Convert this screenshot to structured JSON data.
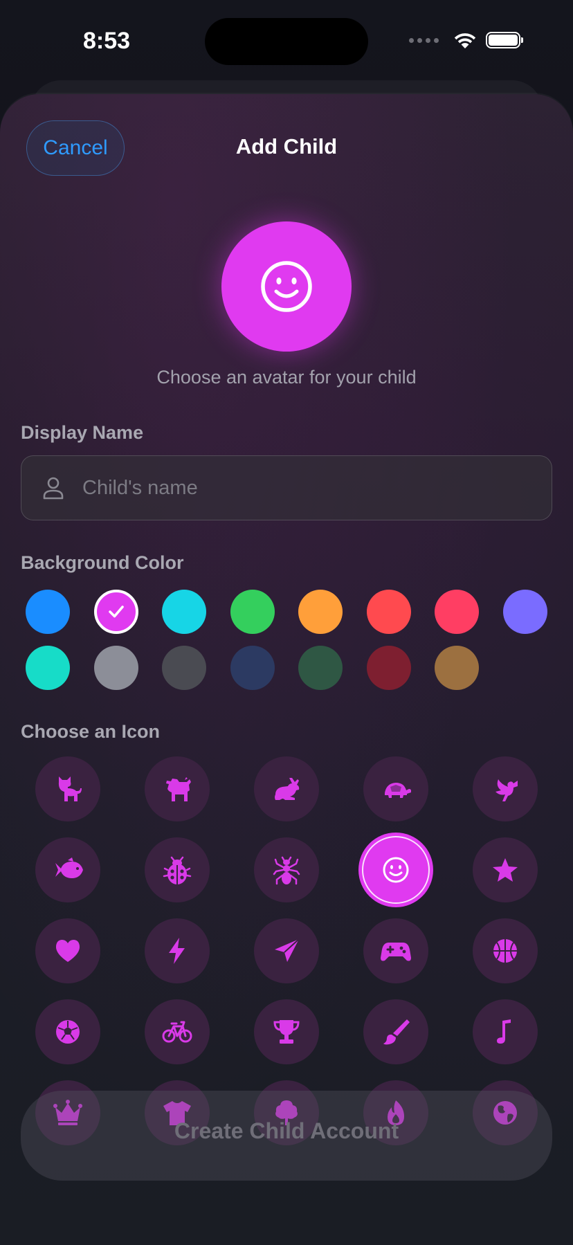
{
  "status_bar": {
    "time": "8:53"
  },
  "header": {
    "cancel_label": "Cancel",
    "title": "Add Child"
  },
  "avatar": {
    "icon": "smiley-face-icon",
    "color": "#e03af0",
    "caption": "Choose an avatar for your child"
  },
  "display_name": {
    "label": "Display Name",
    "value": "",
    "placeholder": "Child's name"
  },
  "background_color": {
    "label": "Background Color",
    "selected_index": 1,
    "colors": [
      "#1a8dff",
      "#e03af0",
      "#17d5e6",
      "#34cf5d",
      "#ff9f3a",
      "#ff4a4f",
      "#ff3e63",
      "#7a6cff",
      "#17dcc8",
      "#8c8e98",
      "#4a4b52",
      "#2c3a62",
      "#2f5744",
      "#7e1f30",
      "#9c7040"
    ]
  },
  "icon_picker": {
    "label": "Choose an Icon",
    "selected_index": 8,
    "icons": [
      "cat-icon",
      "dog-icon",
      "rabbit-icon",
      "tortoise-icon",
      "bird-icon",
      "fish-icon",
      "ladybug-icon",
      "ant-icon",
      "smiley-face-icon",
      "star-icon",
      "heart-icon",
      "bolt-icon",
      "paper-plane-icon",
      "gamecontroller-icon",
      "basketball-icon",
      "soccer-ball-icon",
      "bicycle-icon",
      "trophy-icon",
      "paintbrush-icon",
      "music-note-icon",
      "crown-icon",
      "tshirt-icon",
      "tree-icon",
      "flame-icon",
      "globe-icon"
    ]
  },
  "create_button": {
    "label": "Create Child Account"
  }
}
